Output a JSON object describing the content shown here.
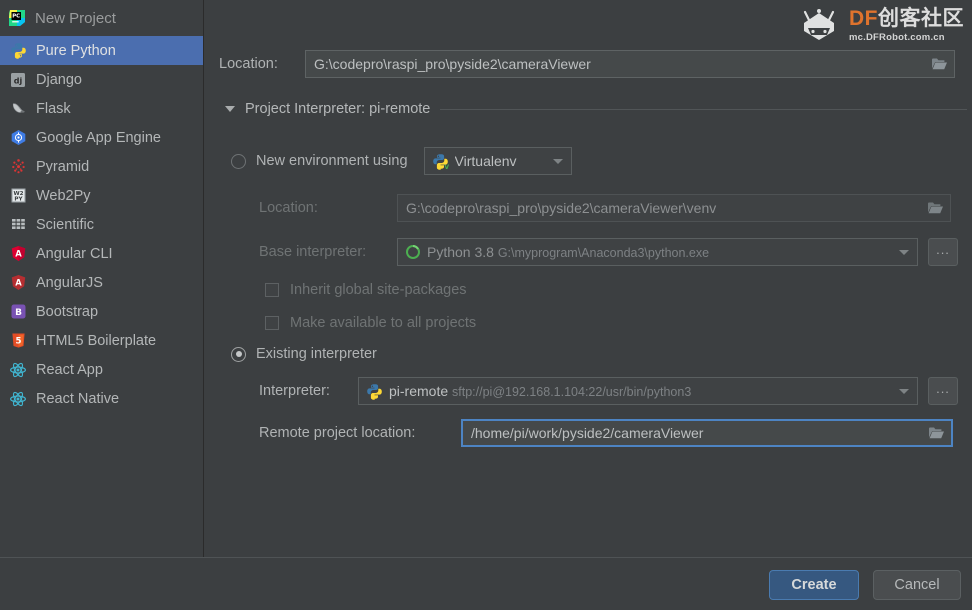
{
  "window": {
    "title": "New Project",
    "app_icon": "pycharm-icon"
  },
  "watermark": {
    "brand_latin": "DF",
    "brand_cjk": "创客社区",
    "url": "mc.DFRobot.com.cn",
    "icon": "dfrobot-logo-icon",
    "accent": "#e8762c"
  },
  "sidebar": {
    "items": [
      {
        "label": "Pure Python",
        "icon": "python-icon",
        "selected": true
      },
      {
        "label": "Django",
        "icon": "django-icon",
        "selected": false
      },
      {
        "label": "Flask",
        "icon": "flask-icon",
        "selected": false
      },
      {
        "label": "Google App Engine",
        "icon": "gae-icon",
        "selected": false
      },
      {
        "label": "Pyramid",
        "icon": "pyramid-icon",
        "selected": false
      },
      {
        "label": "Web2Py",
        "icon": "web2py-icon",
        "selected": false
      },
      {
        "label": "Scientific",
        "icon": "scientific-icon",
        "selected": false
      },
      {
        "label": "Angular CLI",
        "icon": "angular-icon",
        "selected": false
      },
      {
        "label": "AngularJS",
        "icon": "angularjs-icon",
        "selected": false
      },
      {
        "label": "Bootstrap",
        "icon": "bootstrap-icon",
        "selected": false
      },
      {
        "label": "HTML5 Boilerplate",
        "icon": "html5-icon",
        "selected": false
      },
      {
        "label": "React App",
        "icon": "react-icon",
        "selected": false
      },
      {
        "label": "React Native",
        "icon": "react-icon",
        "selected": false
      }
    ]
  },
  "main": {
    "location": {
      "label": "Location:",
      "value": "G:\\codepro\\raspi_pro\\pyside2\\cameraViewer",
      "browse_icon": "folder-icon"
    },
    "section": {
      "label": "Project Interpreter: pi-remote",
      "expanded": true,
      "toggle_icon": "triangle-down-icon"
    },
    "new_env": {
      "radio_label": "New environment using",
      "selected": false,
      "env_type": "Virtualenv",
      "env_type_icon": "virtualenv-icon",
      "location": {
        "label": "Location:",
        "value": "G:\\codepro\\raspi_pro\\pyside2\\cameraViewer\\venv",
        "browse_icon": "folder-icon"
      },
      "base_interpreter": {
        "label": "Base interpreter:",
        "value": "Python 3.8",
        "path": "G:\\myprogram\\Anaconda3\\python.exe",
        "icon": "python-green-icon",
        "more_button": "..."
      },
      "checkboxes": [
        {
          "label": "Inherit global site-packages",
          "checked": false
        },
        {
          "label": "Make available to all projects",
          "checked": false
        }
      ]
    },
    "existing": {
      "radio_label": "Existing interpreter",
      "selected": true,
      "interpreter": {
        "label": "Interpreter:",
        "value": "pi-remote",
        "path": "sftp://pi@192.168.1.104:22/usr/bin/python3",
        "icon": "python-remote-icon",
        "more_button": "..."
      },
      "remote_location": {
        "label": "Remote project location:",
        "value": "/home/pi/work/pyside2/cameraViewer",
        "browse_icon": "folder-icon",
        "focused": true,
        "focus_color": "#4d84c3"
      }
    }
  },
  "footer": {
    "create_label": "Create",
    "cancel_label": "Cancel",
    "create_color": "#365880"
  }
}
